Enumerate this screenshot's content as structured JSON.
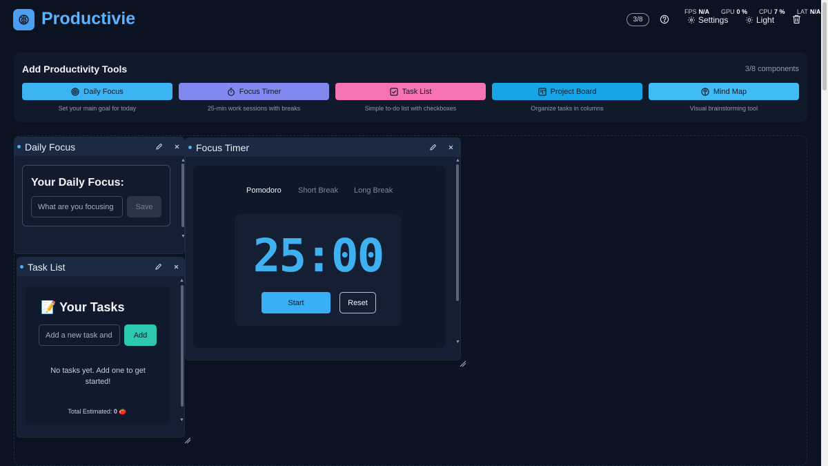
{
  "app": {
    "brand": "Productivie"
  },
  "header": {
    "counter": "3/8",
    "stats": {
      "fps_label": "FPS",
      "fps_value": "N/A",
      "gpu_label": "GPU",
      "gpu_value": "0 %",
      "cpu_label": "CPU",
      "cpu_value": "7 %",
      "lat_label": "LAT",
      "lat_value": "N/A"
    },
    "settings_label": "Settings",
    "theme_label": "Light"
  },
  "tools": {
    "title": "Add Productivity Tools",
    "count": "3/8 components",
    "items": [
      {
        "label": "Daily Focus",
        "desc": "Set your main goal for today",
        "color": "#3cb4f4"
      },
      {
        "label": "Focus Timer",
        "desc": "25-min work sessions with breaks",
        "color": "#8189f0"
      },
      {
        "label": "Task List",
        "desc": "Simple to-do list with checkboxes",
        "color": "#f573b0"
      },
      {
        "label": "Project Board",
        "desc": "Organize tasks in columns",
        "color": "#16a6e8"
      },
      {
        "label": "Mind Map",
        "desc": "Visual brainstorming tool",
        "color": "#3fbcf3"
      }
    ]
  },
  "daily_focus": {
    "title": "Daily Focus",
    "heading": "Your Daily Focus:",
    "placeholder": "What are you focusing on today?",
    "save_label": "Save"
  },
  "task_list": {
    "title": "Task List",
    "heading": "📝 Your Tasks",
    "placeholder": "Add a new task and press Enter",
    "add_label": "Add",
    "empty_message": "No tasks yet. Add one to get started!",
    "total_label": "Total Estimated:",
    "total_value": "0",
    "total_icon": "🍅"
  },
  "focus_timer": {
    "title": "Focus Timer",
    "tabs": [
      "Pomodoro",
      "Short Break",
      "Long Break"
    ],
    "active_tab": "Pomodoro",
    "time": "25:00",
    "start_label": "Start",
    "reset_label": "Reset"
  },
  "colors": {
    "accent": "#5cb2ff",
    "background": "#0b1322",
    "panel": "#111a2b"
  }
}
